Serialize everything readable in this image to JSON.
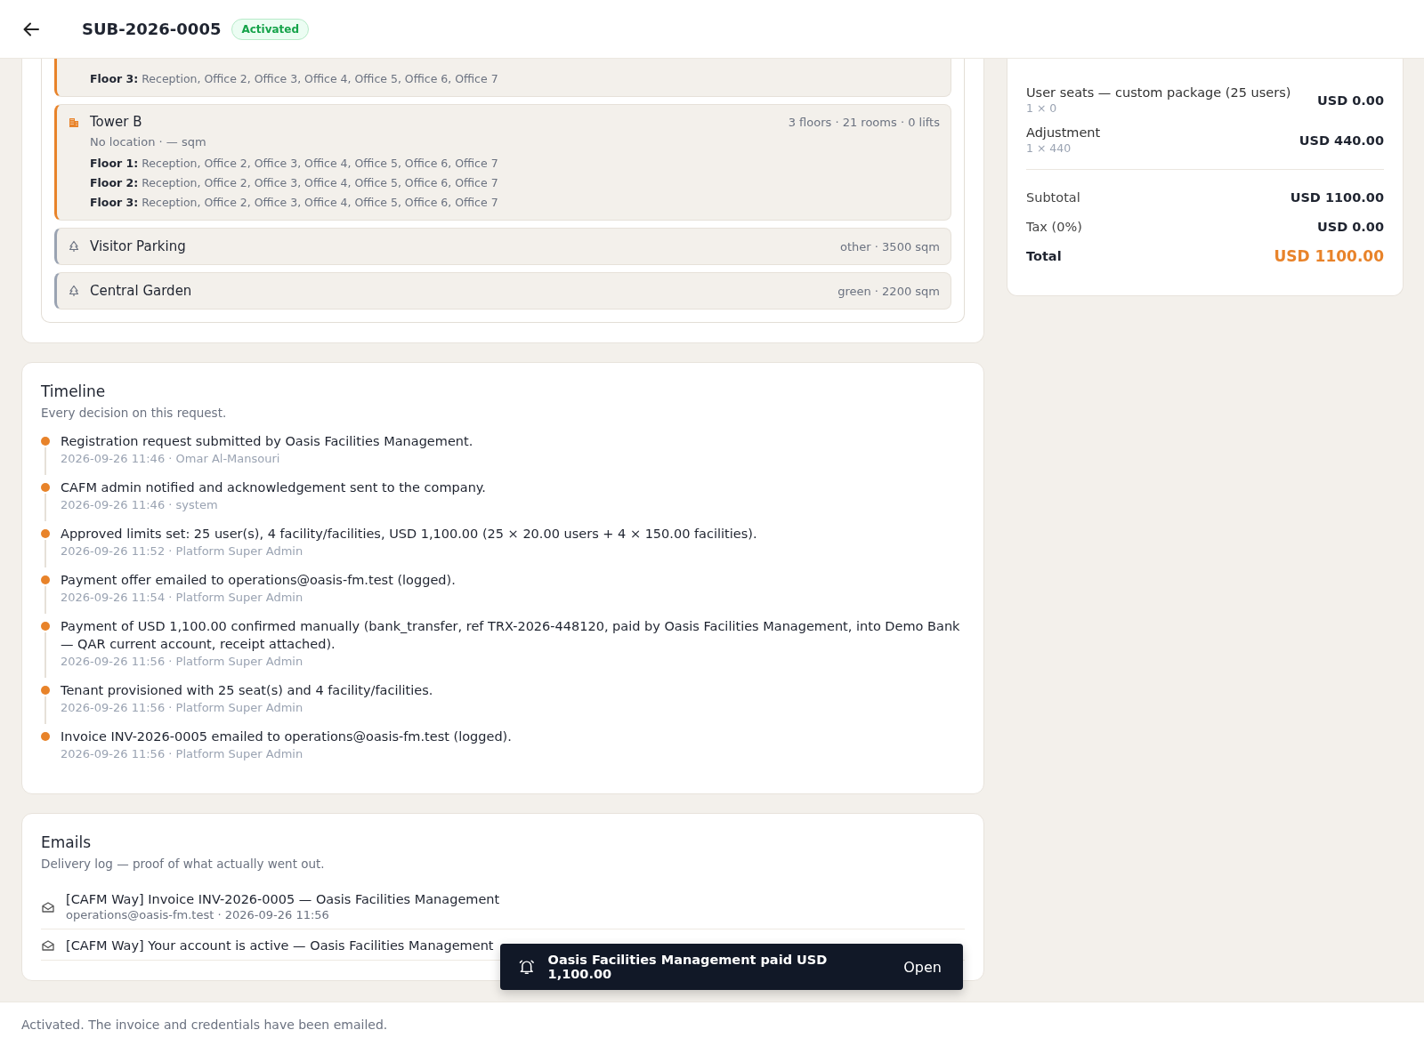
{
  "header": {
    "title": "SUB-2026-0005",
    "status": "Activated"
  },
  "facilities": [
    {
      "kind": "building",
      "floors": [
        {
          "label": "Floor 3:",
          "rooms": "Reception, Office 2, Office 3, Office 4, Office 5, Office 6, Office 7"
        }
      ]
    },
    {
      "kind": "building",
      "name": "Tower B",
      "summary": "3 floors · 21 rooms · 0 lifts",
      "location": "No location · — sqm",
      "floors": [
        {
          "label": "Floor 1:",
          "rooms": "Reception, Office 2, Office 3, Office 4, Office 5, Office 6, Office 7"
        },
        {
          "label": "Floor 2:",
          "rooms": "Reception, Office 2, Office 3, Office 4, Office 5, Office 6, Office 7"
        },
        {
          "label": "Floor 3:",
          "rooms": "Reception, Office 2, Office 3, Office 4, Office 5, Office 6, Office 7"
        }
      ]
    },
    {
      "kind": "area",
      "name": "Visitor Parking",
      "summary": "other · 3500 sqm"
    },
    {
      "kind": "area",
      "name": "Central Garden",
      "summary": "green · 2200 sqm"
    }
  ],
  "timeline": {
    "title": "Timeline",
    "subtitle": "Every decision on this request.",
    "events": [
      {
        "text": "Registration request submitted by Oasis Facilities Management.",
        "meta": "2026-09-26 11:46 · Omar Al-Mansouri"
      },
      {
        "text": "CAFM admin notified and acknowledgement sent to the company.",
        "meta": "2026-09-26 11:46 · system"
      },
      {
        "text": "Approved limits set: 25 user(s), 4 facility/facilities, USD 1,100.00 (25 × 20.00 users + 4 × 150.00 facilities).",
        "meta": "2026-09-26 11:52 · Platform Super Admin"
      },
      {
        "text": "Payment offer emailed to operations@oasis-fm.test (logged).",
        "meta": "2026-09-26 11:54 · Platform Super Admin"
      },
      {
        "text": "Payment of USD 1,100.00 confirmed manually (bank_transfer, ref TRX-2026-448120, paid by Oasis Facilities Management, into Demo Bank — QAR current account, receipt attached).",
        "meta": "2026-09-26 11:56 · Platform Super Admin"
      },
      {
        "text": "Tenant provisioned with 25 seat(s) and 4 facility/facilities.",
        "meta": "2026-09-26 11:56 · Platform Super Admin"
      },
      {
        "text": "Invoice INV-2026-0005 emailed to operations@oasis-fm.test (logged).",
        "meta": "2026-09-26 11:56 · Platform Super Admin"
      }
    ]
  },
  "emails": {
    "title": "Emails",
    "subtitle": "Delivery log — proof of what actually went out.",
    "items": [
      {
        "subject": "[CAFM Way] Invoice INV-2026-0005 — Oasis Facilities Management",
        "meta": "operations@oasis-fm.test · 2026-09-26 11:56"
      },
      {
        "subject": "[CAFM Way] Your account is active — Oasis Facilities Management"
      }
    ]
  },
  "invoice": {
    "lines": [
      {
        "name": "User seats — custom package (25 users)",
        "qty": "1 × 0",
        "amount": "USD 0.00"
      },
      {
        "name": "Adjustment",
        "qty": "1 × 440",
        "amount": "USD 440.00"
      }
    ],
    "totals": [
      {
        "kind": "normal",
        "label": "Subtotal",
        "value": "USD 1100.00"
      },
      {
        "kind": "normal",
        "label": "Tax (0%)",
        "value": "USD 0.00"
      },
      {
        "kind": "grand",
        "label": "Total",
        "value": "USD 1100.00"
      }
    ]
  },
  "toast": {
    "text": "Oasis Facilities Management paid USD 1,100.00",
    "action": "Open"
  },
  "status_bar": "Activated. The invoice and credentials have been emailed."
}
